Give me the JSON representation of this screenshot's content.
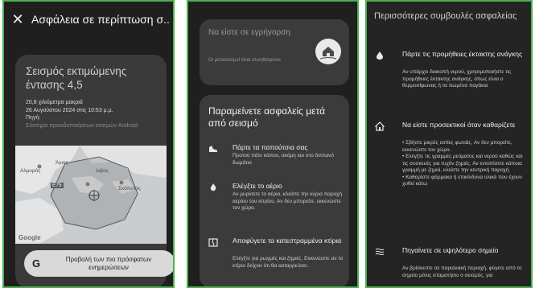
{
  "panel1": {
    "title": "Ασφάλεια σε περίπτωση σ...",
    "card": {
      "title": "Σεισμός εκτιμώμενης έντασης 4,5",
      "distance": "20,8 χιλιόμετρα μακριά",
      "datetime": "26 Αυγούστου 2024 στις 10:53 μ.μ.",
      "source_label": "Πηγή:",
      "source_value": "Σύστημα προειδοποιήσεων σεισμών Android"
    },
    "map": {
      "labels": [
        "Άγιος",
        "Αλμυρός",
        "Ιαβος",
        "Σκόπελος",
        "E75"
      ],
      "logo": "Google"
    },
    "button": {
      "icon_letter": "G",
      "label": "Προβολή των πιο πρόσφατων ενημερώσεων"
    }
  },
  "panel2": {
    "alert": {
      "title": "Να είστε σε εγρήγορση",
      "subtitle": "Οι μετασεισμοί είναι συνηθισμένοι"
    },
    "safety": {
      "title": "Παραμείνετε ασφαλείς μετά από σεισμό",
      "tips": [
        {
          "icon": "shoe-icon",
          "title": "Πάρτε τα παπούτσια σας",
          "desc": "Προτού πάτε κάπου, ακόμη και στο διπλανό δωμάτιο"
        },
        {
          "icon": "flame-icon",
          "title": "Ελέγξτε το αέριο",
          "desc": "Αν μυρίσετε το αέριο, κλείστε την κύρια παροχή αερίου του κτιρίου. Αν δεν μπορείτε, εκκενώστε τον χώρο."
        },
        {
          "icon": "damaged-building-icon",
          "title": "Αποφύγετε τα κατεστραμμένα κτίρια",
          "desc": "Ελέγξτε για ρωγμές και ζημιές. Εκκενώστε αν το κτίριο δείχνει ότι θα καταρρεύσει."
        }
      ]
    }
  },
  "panel3": {
    "title": "Περισσότερες συμβουλές ασφαλείας",
    "items": [
      {
        "icon": "water-drop-icon",
        "title": "Πάρτε τις προμήθειες έκτακτης ανάγκης",
        "desc": "Αν υπάρχει διακοπή νερού, χρησιμοποιήστε τις προμήθειες έκτακτης ανάγκης, όπως είναι ο θερμοσίφωνας ή τα λιωμένα παγάκια"
      },
      {
        "icon": "home-icon",
        "title": "Να είστε προσεκτικοί όταν καθαρίζετε",
        "bullets": [
          "• Σβήστε μικρές εστίες φωτιάς. Αν δεν μπορείτε, εκκενώστε τον χώρο.",
          "• Ελέγξτε τις γραμμές ρεύματος και νερού καθώς και τις συσκευές για τυχόν ζημιές. Αν εντοπίσετε κάποια γραμμή με ζημιά, κλείστε την κεντρική παροχή.",
          "• Καθαρίστε φάρμακα ή επικίνδυνα υλικά που έχουν χυθεί κάτω"
        ]
      },
      {
        "icon": "waves-icon",
        "title": "Πηγαίνετε σε υψηλότερο σημείο",
        "desc": "Αν βρίσκεστε σε παραλιακή περιοχή, φύγετε από το σημείο μόλις σταματήσει ο σεισμός, για"
      }
    ]
  },
  "colors": {
    "frame": "#4caf50",
    "card": "#3b3b3b",
    "background": "#1f1f1f",
    "button": "#d9d9d9"
  }
}
